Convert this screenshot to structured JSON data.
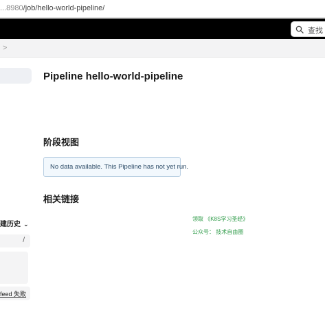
{
  "browser": {
    "url_host": "...8980",
    "url_path": "/job/hello-world-pipeline/"
  },
  "header": {
    "search_placeholder": "查找 (⌘"
  },
  "breadcrumb": {
    "separator": ">"
  },
  "sidebar": {
    "build_history_label": "建历史",
    "build_filter_slash": "/",
    "feed_label": "feed 失败"
  },
  "main": {
    "title": "Pipeline hello-world-pipeline",
    "stage_view_heading": "阶段视图",
    "no_data_message": "No data available. This Pipeline has not yet run.",
    "related_links_heading": "相关链接"
  },
  "watermark": {
    "line1": "领取 《K8S学习圣经》",
    "line2": "公众号： 技术自由圈"
  },
  "colors": {
    "topnav_bg": "#000000",
    "crumbbar_bg": "#f3f3f4",
    "info_box_bg": "#f2f8fd",
    "info_box_border": "#b9cfe2",
    "watermark_text": "#2e9b48"
  },
  "icons": {
    "search": "search-icon",
    "chevron_down": "chevron-down-icon",
    "chevron_right": "chevron-right-icon"
  }
}
